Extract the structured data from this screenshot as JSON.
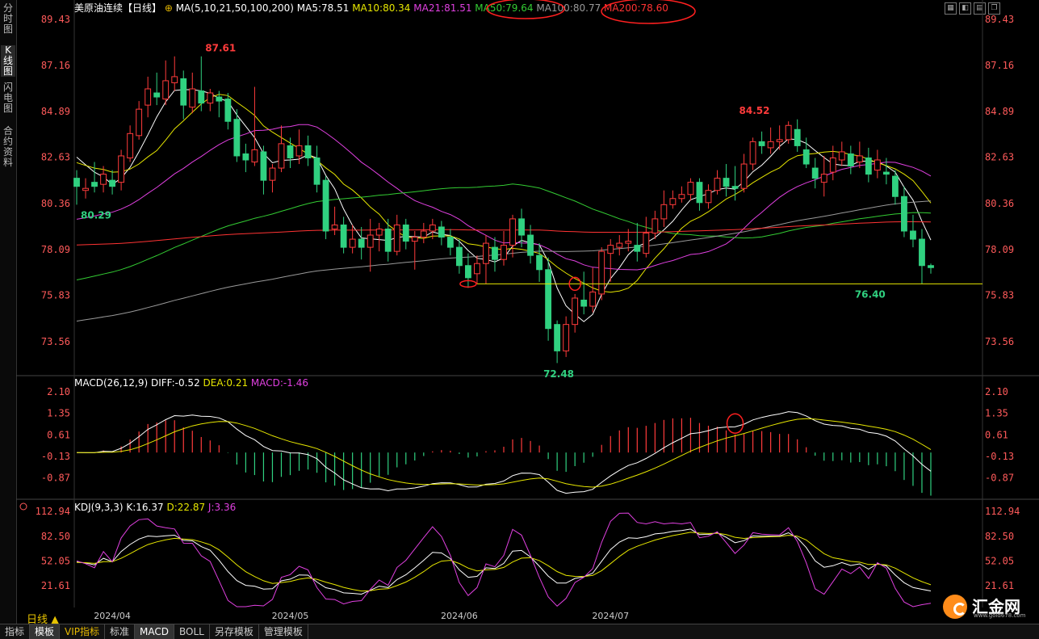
{
  "sidebar": {
    "tabs": [
      "分时图",
      "K线图",
      "闪电图",
      "合约资料"
    ]
  },
  "header": {
    "title": "美原油连续【日线】",
    "ma_label": "MA(5,10,21,50,100,200)",
    "ma_values": [
      {
        "text": "MA5:78.51",
        "color": "#ffffff"
      },
      {
        "text": "MA10:80.34",
        "color": "#e6e600"
      },
      {
        "text": "MA21:81.51",
        "color": "#e040e0"
      },
      {
        "text": "MA50:79.64",
        "color": "#33cc33"
      },
      {
        "text": "MA100:80.77",
        "color": "#999999"
      },
      {
        "text": "MA200:78.60",
        "color": "#ff3333"
      }
    ]
  },
  "macd_header": {
    "label": "MACD(26,12,9)",
    "diff": "DIFF:-0.52",
    "dea": "DEA:0.21",
    "macd": "MACD:-1.46"
  },
  "kdj_header": {
    "label": "KDJ(9,3,3)",
    "k": "K:16.37",
    "d": "D:22.87",
    "j": "J:3.36"
  },
  "x_labels": [
    "2024/04",
    "2024/05",
    "2024/06",
    "2024/07"
  ],
  "period": "日线 ▲",
  "bottom_tabs": [
    "指标",
    "模板",
    "VIP指标",
    "标准",
    "MACD",
    "BOLL",
    "另存模板",
    "管理模板"
  ],
  "logo": {
    "name": "汇金网",
    "url": "www.gold678.com"
  },
  "colors": {
    "up": "#ff3b3b",
    "down": "#30d180",
    "ma5": "#ffffff",
    "ma10": "#e6e600",
    "ma21": "#e040e0",
    "ma50": "#33cc33",
    "ma100": "#999999",
    "ma200": "#ff3333",
    "support": "#e6e600"
  },
  "chart_data": [
    {
      "type": "candlestick",
      "title": "美原油连续【日线】",
      "yticks": [
        89.43,
        87.16,
        84.89,
        82.63,
        80.36,
        78.09,
        75.83,
        73.56
      ],
      "ylim": [
        72.0,
        89.5
      ],
      "support_line": 76.4,
      "annotations": [
        {
          "text": "87.61",
          "value": 87.61,
          "x_index": 14
        },
        {
          "text": "80.29",
          "value": 80.29,
          "x_index": 0
        },
        {
          "text": "72.48",
          "value": 72.48,
          "x_index": 52
        },
        {
          "text": "84.52",
          "value": 84.52,
          "x_index": 74
        },
        {
          "text": "76.40",
          "value": 76.4,
          "x_index": 87
        }
      ],
      "x_categories": [
        "2024/04",
        "2024/05",
        "2024/06",
        "2024/07"
      ],
      "ohlc": [
        [
          81.6,
          81.2,
          82.0,
          80.3
        ],
        [
          81.0,
          81.1,
          81.6,
          80.6
        ],
        [
          81.4,
          81.2,
          82.4,
          80.9
        ],
        [
          81.3,
          81.8,
          82.2,
          80.9
        ],
        [
          81.5,
          81.2,
          82.0,
          80.8
        ],
        [
          81.4,
          82.7,
          83.0,
          81.0
        ],
        [
          82.6,
          83.8,
          84.2,
          82.4
        ],
        [
          83.7,
          85.0,
          85.4,
          83.5
        ],
        [
          85.2,
          86.0,
          86.6,
          84.6
        ],
        [
          85.8,
          85.6,
          86.8,
          85.2
        ],
        [
          85.5,
          86.4,
          87.4,
          85.2
        ],
        [
          86.3,
          86.6,
          87.6,
          85.9
        ],
        [
          86.5,
          85.2,
          86.9,
          84.5
        ],
        [
          85.1,
          86.0,
          86.8,
          84.8
        ],
        [
          85.9,
          85.3,
          87.6,
          84.9
        ],
        [
          85.3,
          85.8,
          86.0,
          84.9
        ],
        [
          85.6,
          85.4,
          85.9,
          84.6
        ],
        [
          85.5,
          84.4,
          85.8,
          84.0
        ],
        [
          84.5,
          82.7,
          85.0,
          82.4
        ],
        [
          82.8,
          82.5,
          83.3,
          81.9
        ],
        [
          82.4,
          83.0,
          86.1,
          82.2
        ],
        [
          82.9,
          81.5,
          83.2,
          80.8
        ],
        [
          81.5,
          82.1,
          82.3,
          80.9
        ],
        [
          82.1,
          83.3,
          84.2,
          81.9
        ],
        [
          83.2,
          82.6,
          83.6,
          82.1
        ],
        [
          82.7,
          83.2,
          84.0,
          82.3
        ],
        [
          83.2,
          82.6,
          83.7,
          82.2
        ],
        [
          82.6,
          81.3,
          83.2,
          80.9
        ],
        [
          81.5,
          79.0,
          81.7,
          78.6
        ],
        [
          79.1,
          79.3,
          80.2,
          78.8
        ],
        [
          79.3,
          78.2,
          79.7,
          77.9
        ],
        [
          78.2,
          78.6,
          79.3,
          77.9
        ],
        [
          78.6,
          78.2,
          79.2,
          77.6
        ],
        [
          78.2,
          78.8,
          79.6,
          77.0
        ],
        [
          78.8,
          79.1,
          79.4,
          78.0
        ],
        [
          79.1,
          78.0,
          79.6,
          77.5
        ],
        [
          78.0,
          79.3,
          79.8,
          77.8
        ],
        [
          79.3,
          78.5,
          79.6,
          78.1
        ],
        [
          78.5,
          78.7,
          79.0,
          77.1
        ],
        [
          78.7,
          79.0,
          79.4,
          78.4
        ],
        [
          79.0,
          79.3,
          79.6,
          78.6
        ],
        [
          79.2,
          78.7,
          79.5,
          78.3
        ],
        [
          78.7,
          78.2,
          79.1,
          77.8
        ],
        [
          78.2,
          77.3,
          78.6,
          76.9
        ],
        [
          77.3,
          76.7,
          77.9,
          76.2
        ],
        [
          76.9,
          77.4,
          77.8,
          76.4
        ],
        [
          77.4,
          78.4,
          78.8,
          76.4
        ],
        [
          78.2,
          77.6,
          78.7,
          77.0
        ],
        [
          77.6,
          78.3,
          79.0,
          77.3
        ],
        [
          78.3,
          79.6,
          79.8,
          77.7
        ],
        [
          79.6,
          78.8,
          80.1,
          78.2
        ],
        [
          78.8,
          77.8,
          79.3,
          77.4
        ],
        [
          77.8,
          77.1,
          78.4,
          76.5
        ],
        [
          77.1,
          74.2,
          77.7,
          73.6
        ],
        [
          74.4,
          73.1,
          74.6,
          72.5
        ],
        [
          73.1,
          74.4,
          74.8,
          72.8
        ],
        [
          74.4,
          75.7,
          75.9,
          74.0
        ],
        [
          75.6,
          75.3,
          77.0,
          74.9
        ],
        [
          75.3,
          76.0,
          77.2,
          75.0
        ],
        [
          75.9,
          78.0,
          78.2,
          75.6
        ],
        [
          77.9,
          78.3,
          78.6,
          76.5
        ],
        [
          78.2,
          78.4,
          78.8,
          77.8
        ],
        [
          78.4,
          78.5,
          79.1,
          78.0
        ],
        [
          78.3,
          78.0,
          79.4,
          77.5
        ],
        [
          77.9,
          78.9,
          79.7,
          77.7
        ],
        [
          78.9,
          79.6,
          80.0,
          78.6
        ],
        [
          79.6,
          80.3,
          81.0,
          79.2
        ],
        [
          80.3,
          80.6,
          81.0,
          80.1
        ],
        [
          80.6,
          80.8,
          81.2,
          80.4
        ],
        [
          80.8,
          81.4,
          81.6,
          80.5
        ],
        [
          81.4,
          80.4,
          81.6,
          80.0
        ],
        [
          80.4,
          81.0,
          81.3,
          80.1
        ],
        [
          81.0,
          81.6,
          82.0,
          80.8
        ],
        [
          81.6,
          81.2,
          82.3,
          80.7
        ],
        [
          81.2,
          81.1,
          82.2,
          80.5
        ],
        [
          81.1,
          82.3,
          82.8,
          80.9
        ],
        [
          82.3,
          83.4,
          83.6,
          82.0
        ],
        [
          83.4,
          83.2,
          83.9,
          82.8
        ],
        [
          83.1,
          83.4,
          84.1,
          82.8
        ],
        [
          83.4,
          83.5,
          84.2,
          83.0
        ],
        [
          83.5,
          84.2,
          84.4,
          83.3
        ],
        [
          84.0,
          83.2,
          84.5,
          82.9
        ],
        [
          83.0,
          82.3,
          83.6,
          82.1
        ],
        [
          82.1,
          81.6,
          82.6,
          81.1
        ],
        [
          81.4,
          81.8,
          82.7,
          80.7
        ],
        [
          81.9,
          82.6,
          83.2,
          81.5
        ],
        [
          82.5,
          82.9,
          83.4,
          82.2
        ],
        [
          82.8,
          82.2,
          83.2,
          81.8
        ],
        [
          82.4,
          82.7,
          83.4,
          82.1
        ],
        [
          82.6,
          81.8,
          83.1,
          81.4
        ],
        [
          82.0,
          82.5,
          83.0,
          81.6
        ],
        [
          81.9,
          81.8,
          82.6,
          81.3
        ],
        [
          81.7,
          80.7,
          82.0,
          80.3
        ],
        [
          80.7,
          79.0,
          81.2,
          78.7
        ],
        [
          79.0,
          78.6,
          79.8,
          78.2
        ],
        [
          78.6,
          77.3,
          79.1,
          76.4
        ],
        [
          77.3,
          77.2,
          77.4,
          76.9
        ]
      ]
    },
    {
      "type": "bar",
      "title": "MACD(26,12,9)",
      "yticks": [
        2.1,
        1.35,
        0.61,
        -0.13,
        -0.87
      ],
      "ylim": [
        -1.5,
        2.4
      ],
      "series": [
        {
          "name": "DIFF",
          "value": -0.52
        },
        {
          "name": "DEA",
          "value": 0.21
        },
        {
          "name": "MACD",
          "value": -1.46
        }
      ]
    },
    {
      "type": "line",
      "title": "KDJ(9,3,3)",
      "yticks": [
        112.94,
        82.5,
        52.05,
        21.61
      ],
      "ylim": [
        -5,
        122
      ],
      "series": [
        {
          "name": "K",
          "value": 16.37
        },
        {
          "name": "D",
          "value": 22.87
        },
        {
          "name": "J",
          "value": 3.36
        }
      ]
    }
  ]
}
